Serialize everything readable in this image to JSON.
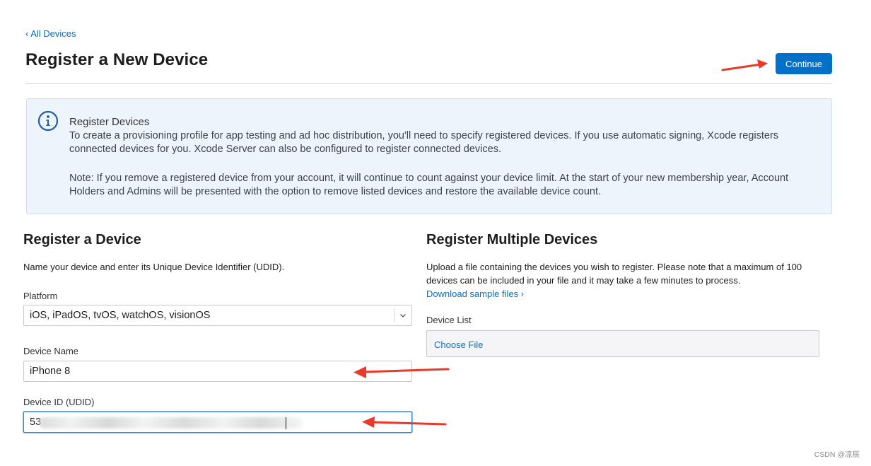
{
  "nav": {
    "back_label": "‹ All Devices"
  },
  "header": {
    "title": "Register a New Device",
    "continue_label": "Continue"
  },
  "info": {
    "icon": "info-icon",
    "title": "Register Devices",
    "paragraph": "To create a provisioning profile for app testing and ad hoc distribution, you'll need to specify registered devices. If you use automatic signing, Xcode registers connected devices for you. Xcode Server can also be configured to register connected devices.",
    "note": "Note: If you remove a registered device from your account, it will continue to count against your device limit. At the start of your new membership year, Account Holders and Admins will be presented with the option to remove listed devices and restore the available device count."
  },
  "single": {
    "title": "Register a Device",
    "description": "Name your device and enter its Unique Device Identifier (UDID).",
    "platform_label": "Platform",
    "platform_value": "iOS, iPadOS, tvOS, watchOS, visionOS",
    "device_name_label": "Device Name",
    "device_name_value": "iPhone 8",
    "udid_label": "Device ID (UDID)",
    "udid_value": "53"
  },
  "multiple": {
    "title": "Register Multiple Devices",
    "description": "Upload a file containing the devices you wish to register. Please note that a maximum of 100 devices can be included in your file and it may take a few minutes to process.",
    "download_link": "Download sample files ›",
    "list_label": "Device List",
    "choose_file": "Choose File"
  },
  "colors": {
    "accent": "#0070c9",
    "annotation_arrow": "#e8392b",
    "info_bg": "#eef4fc"
  },
  "watermark": "CSDN @凉辰"
}
